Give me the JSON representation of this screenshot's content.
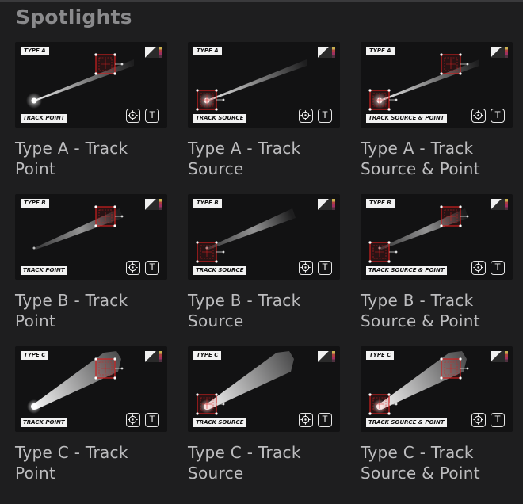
{
  "section": {
    "title": "Spotlights"
  },
  "icons": {
    "target": "crosshair-icon",
    "text": "text-tool-icon",
    "swatch": "color-swatch-icon"
  },
  "colors": {
    "background": "#1e1e1f",
    "thumbnail": "#121213",
    "handle_red": "#d02020",
    "label_text": "#bdbdbf",
    "title_text": "#8a8a8c"
  },
  "tiles": [
    {
      "type_tag": "TYPE A",
      "mode_tag": "TRACK POINT",
      "text_icon": "T",
      "label": "Type A - Track Point"
    },
    {
      "type_tag": "TYPE A",
      "mode_tag": "TRACK SOURCE",
      "text_icon": "T",
      "label": "Type A - Track Source"
    },
    {
      "type_tag": "TYPE A",
      "mode_tag": "TRACK SOURCE & POINT",
      "text_icon": "T",
      "label": "Type A - Track Source & Point"
    },
    {
      "type_tag": "TYPE B",
      "mode_tag": "TRACK POINT",
      "text_icon": "T",
      "label": "Type B - Track Point"
    },
    {
      "type_tag": "TYPE B",
      "mode_tag": "TRACK SOURCE",
      "text_icon": "T",
      "label": "Type B - Track Source"
    },
    {
      "type_tag": "TYPE B",
      "mode_tag": "TRACK SOURCE & POINT",
      "text_icon": "T",
      "label": "Type B - Track Source & Point"
    },
    {
      "type_tag": "TYPE C",
      "mode_tag": "TRACK POINT",
      "text_icon": "T",
      "label": "Type C - Track Point"
    },
    {
      "type_tag": "TYPE C",
      "mode_tag": "TRACK SOURCE",
      "text_icon": "T",
      "label": "Type C - Track Source"
    },
    {
      "type_tag": "TYPE C",
      "mode_tag": "TRACK SOURCE & POINT",
      "text_icon": "T",
      "label": "Type C - Track Source & Point"
    }
  ]
}
